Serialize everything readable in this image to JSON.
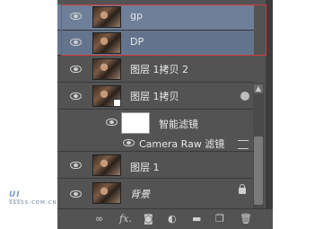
{
  "layers": [
    {
      "name": "gp",
      "visible": true,
      "selected": true
    },
    {
      "name": "DP",
      "visible": true,
      "selected": true
    },
    {
      "name": "图层 1拷贝 2",
      "visible": true
    },
    {
      "name": "图层 1拷贝",
      "visible": true,
      "smart_object": true
    },
    {
      "name": "智能滤镜",
      "visible": true
    },
    {
      "name": "Camera Raw 滤镜",
      "visible": true
    },
    {
      "name": "图层 1",
      "visible": true
    },
    {
      "name": "背景",
      "visible": true,
      "locked": true
    }
  ],
  "footer": {
    "link_icon": "link-icon",
    "fx_label": "fx.",
    "mask_icon": "mask-icon",
    "adjustment_icon": "adjustment-icon",
    "group_icon": "folder-icon",
    "new_layer_icon": "new-layer-icon",
    "delete_icon": "trash-icon"
  },
  "watermark": {
    "text": "UI",
    "sub": "SSSSS.COM.CN"
  },
  "colors": {
    "panel": "#535353",
    "selection": "#6e7f99",
    "highlight_box": "#d23a3a"
  }
}
